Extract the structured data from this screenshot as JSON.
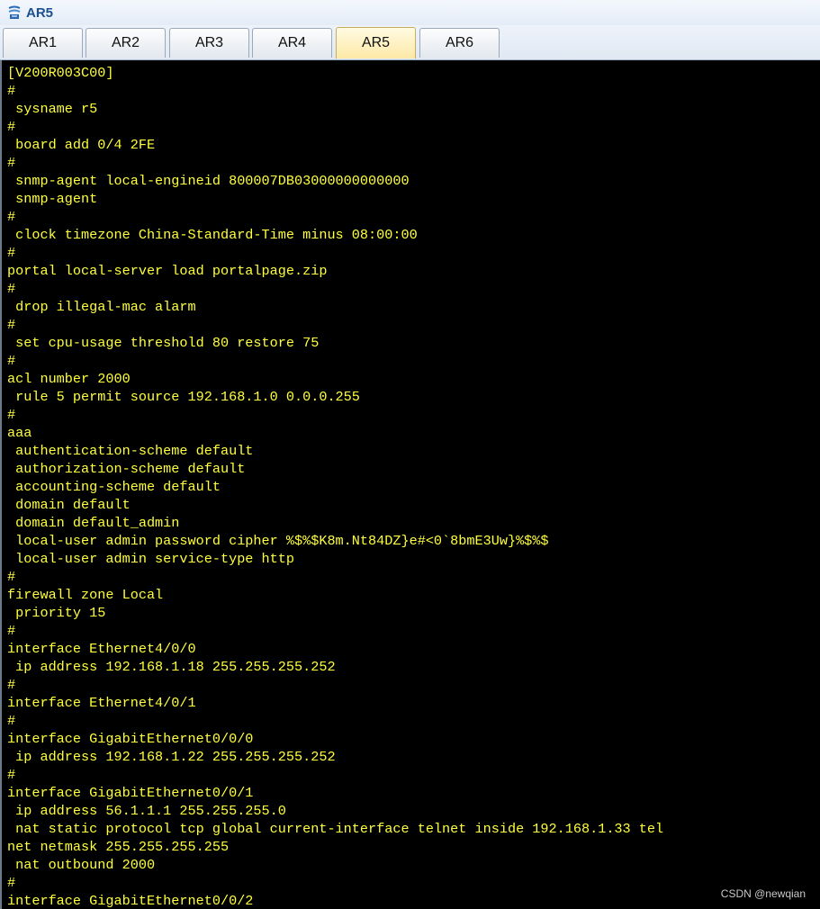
{
  "window": {
    "title": "AR5",
    "icon": "router-app-icon"
  },
  "tabs": [
    {
      "label": "AR1",
      "active": false
    },
    {
      "label": "AR2",
      "active": false
    },
    {
      "label": "AR3",
      "active": false
    },
    {
      "label": "AR4",
      "active": false
    },
    {
      "label": "AR5",
      "active": true
    },
    {
      "label": "AR6",
      "active": false
    }
  ],
  "terminal": {
    "text_color": "#ffff3c",
    "background": "#000000",
    "lines": [
      "[V200R003C00]",
      "#",
      " sysname r5",
      "#",
      " board add 0/4 2FE",
      "#",
      " snmp-agent local-engineid 800007DB03000000000000",
      " snmp-agent",
      "#",
      " clock timezone China-Standard-Time minus 08:00:00",
      "#",
      "portal local-server load portalpage.zip",
      "#",
      " drop illegal-mac alarm",
      "#",
      " set cpu-usage threshold 80 restore 75",
      "#",
      "acl number 2000",
      " rule 5 permit source 192.168.1.0 0.0.0.255",
      "#",
      "aaa",
      " authentication-scheme default",
      " authorization-scheme default",
      " accounting-scheme default",
      " domain default",
      " domain default_admin",
      " local-user admin password cipher %$%$K8m.Nt84DZ}e#<0`8bmE3Uw}%$%$",
      " local-user admin service-type http",
      "#",
      "firewall zone Local",
      " priority 15",
      "#",
      "interface Ethernet4/0/0",
      " ip address 192.168.1.18 255.255.255.252",
      "#",
      "interface Ethernet4/0/1",
      "#",
      "interface GigabitEthernet0/0/0",
      " ip address 192.168.1.22 255.255.255.252",
      "#",
      "interface GigabitEthernet0/0/1",
      " ip address 56.1.1.1 255.255.255.0",
      " nat static protocol tcp global current-interface telnet inside 192.168.1.33 tel",
      "net netmask 255.255.255.255",
      " nat outbound 2000",
      "#",
      "interface GigabitEthernet0/0/2"
    ]
  },
  "watermark": "CSDN @newqian"
}
